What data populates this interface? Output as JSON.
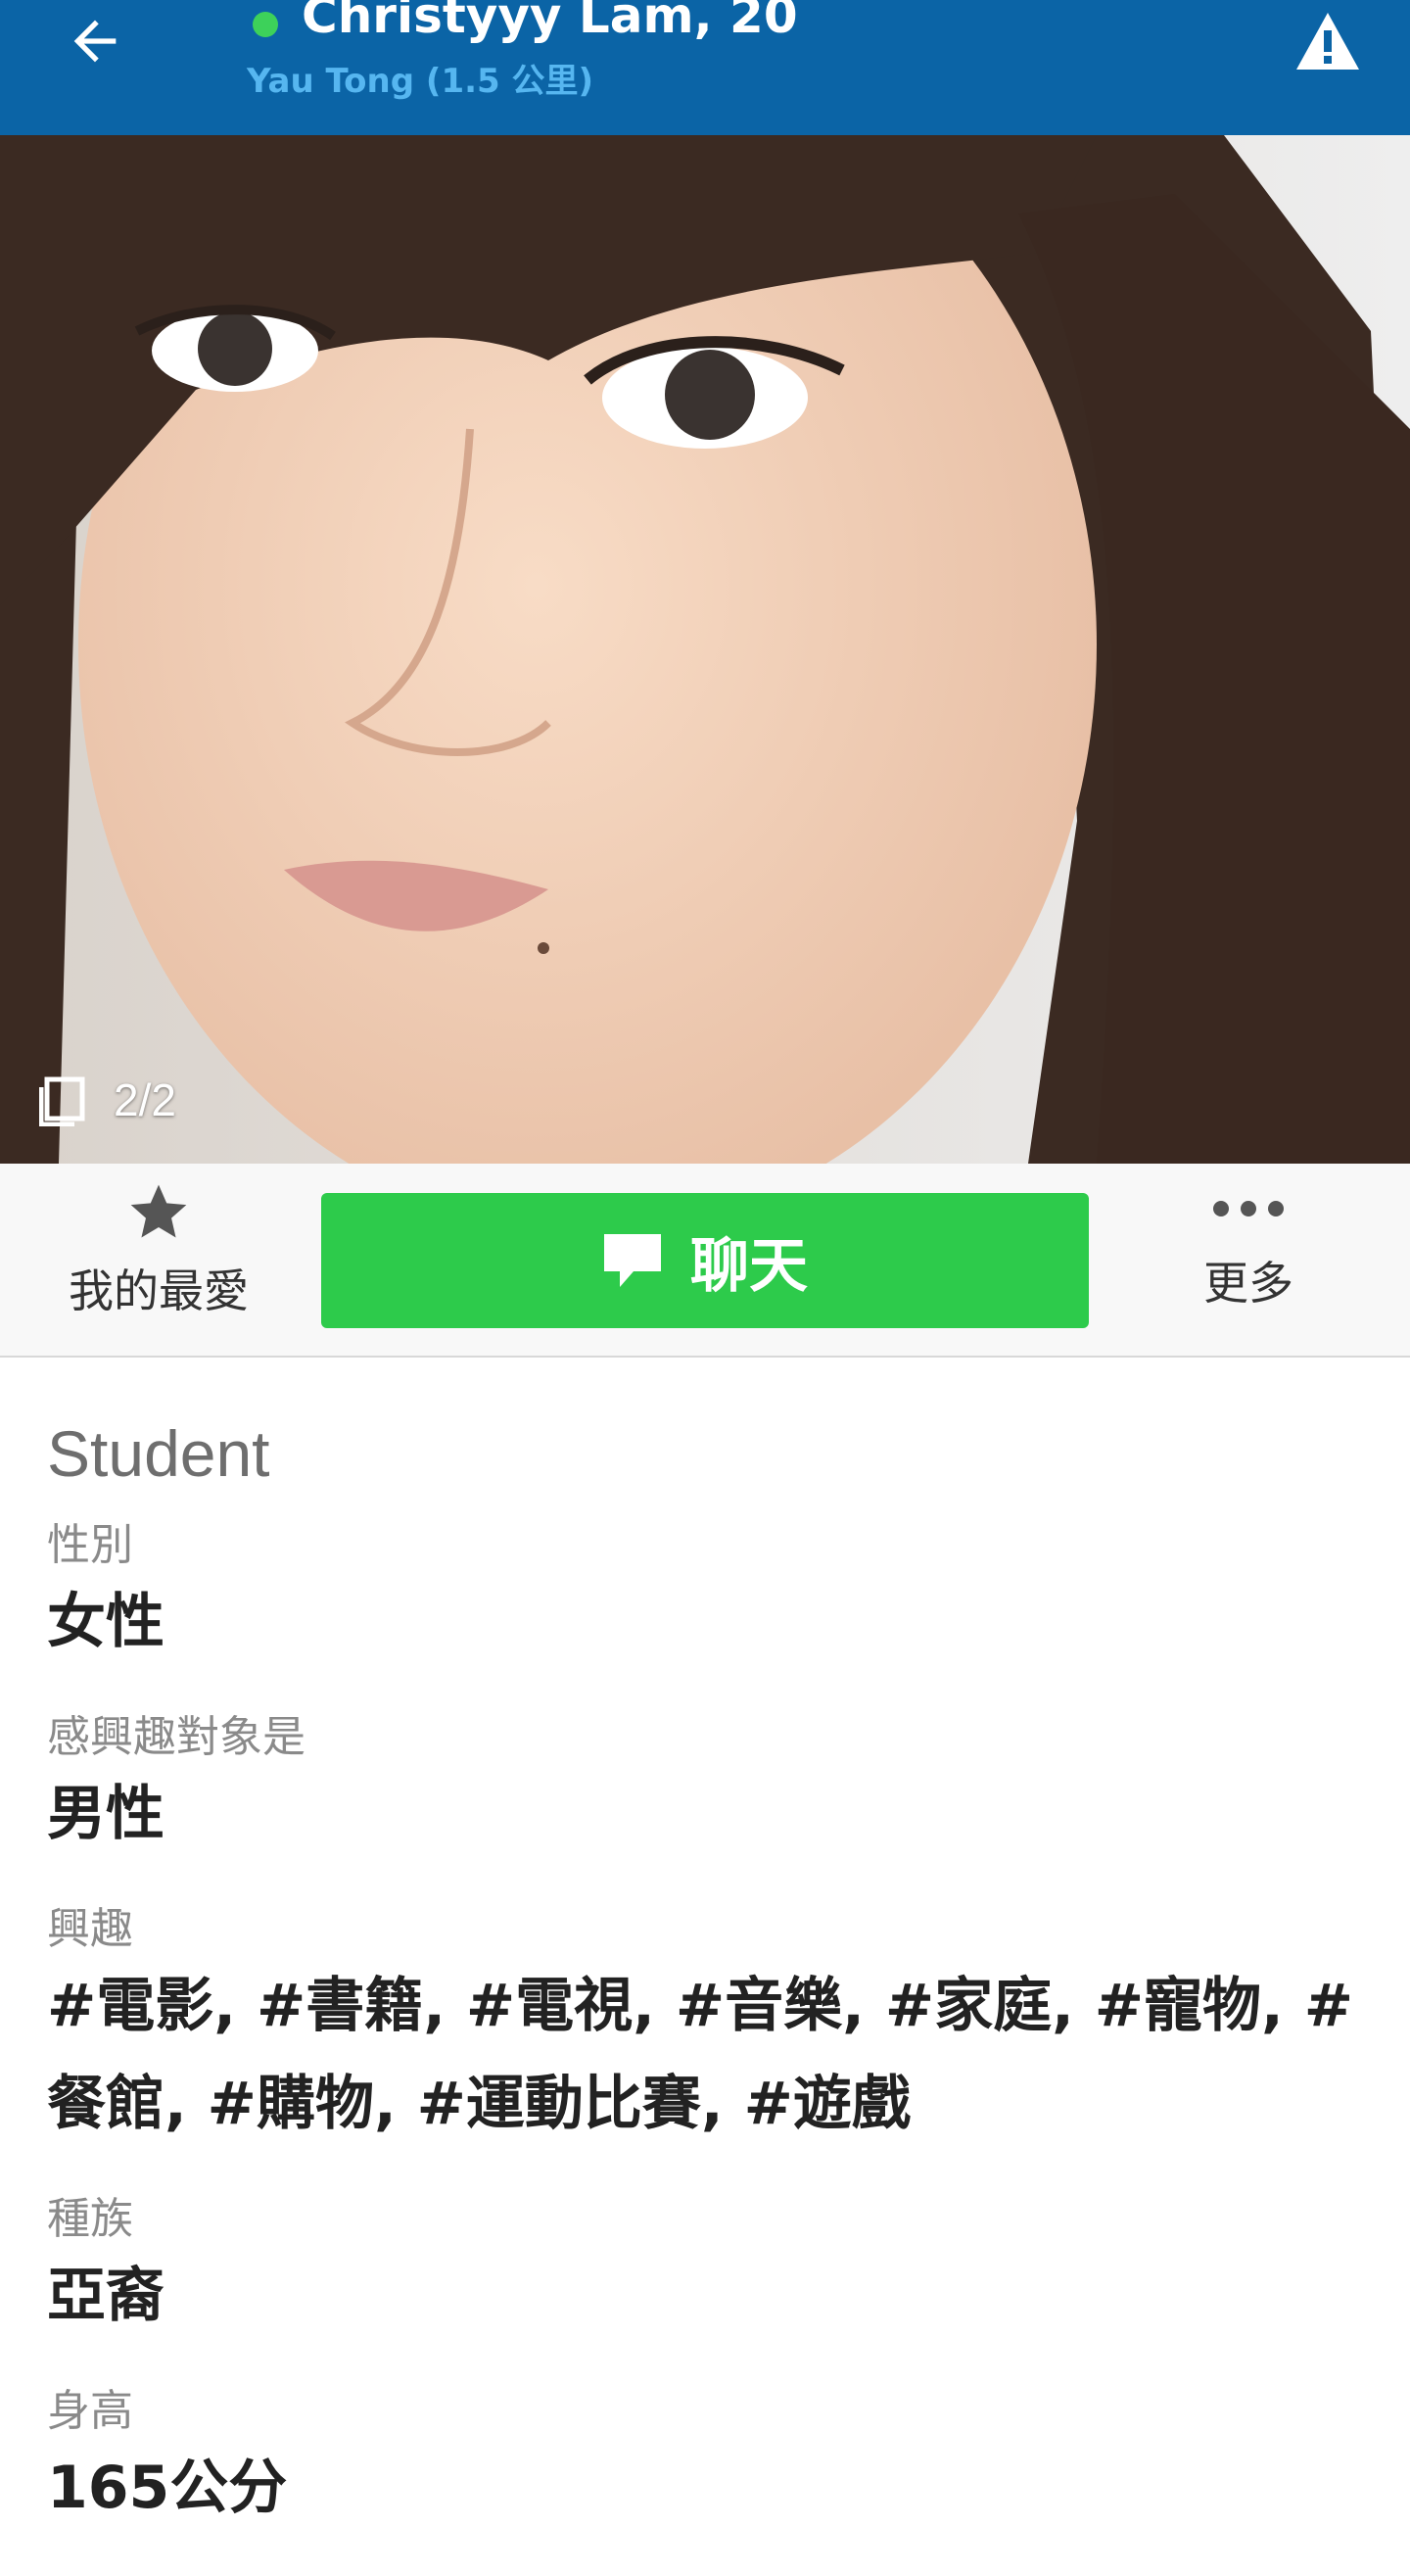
{
  "header": {
    "name": "Christyyy Lam, 20",
    "location": "Yau Tong (1.5 公里)",
    "online": true,
    "colors": {
      "bar": "#0B64A6",
      "online_dot": "#3DD15A",
      "location_text": "#56B6F0"
    },
    "icons": {
      "back": "back-arrow-icon",
      "report": "warning-icon"
    }
  },
  "photo": {
    "counter": "2/2",
    "icon": "photos-stack-icon"
  },
  "actions": {
    "favorite_label": "我的最愛",
    "chat_label": "聊天",
    "more_label": "更多",
    "colors": {
      "chat_button": "#2DCB4B"
    },
    "icons": {
      "favorite": "star-icon",
      "chat": "chat-bubble-icon",
      "more": "more-dots-icon"
    }
  },
  "profile": {
    "occupation": "Student",
    "fields": [
      {
        "label": "性別",
        "value": "女性"
      },
      {
        "label": "感興趣對象是",
        "value": "男性"
      },
      {
        "label": "興趣",
        "value": "#電影, #書籍, #電視, #音樂, #家庭, #寵物, #餐館, #購物, #運動比賽, #遊戲"
      },
      {
        "label": "種族",
        "value": "亞裔"
      },
      {
        "label": "身高",
        "value": "165公分"
      }
    ]
  }
}
